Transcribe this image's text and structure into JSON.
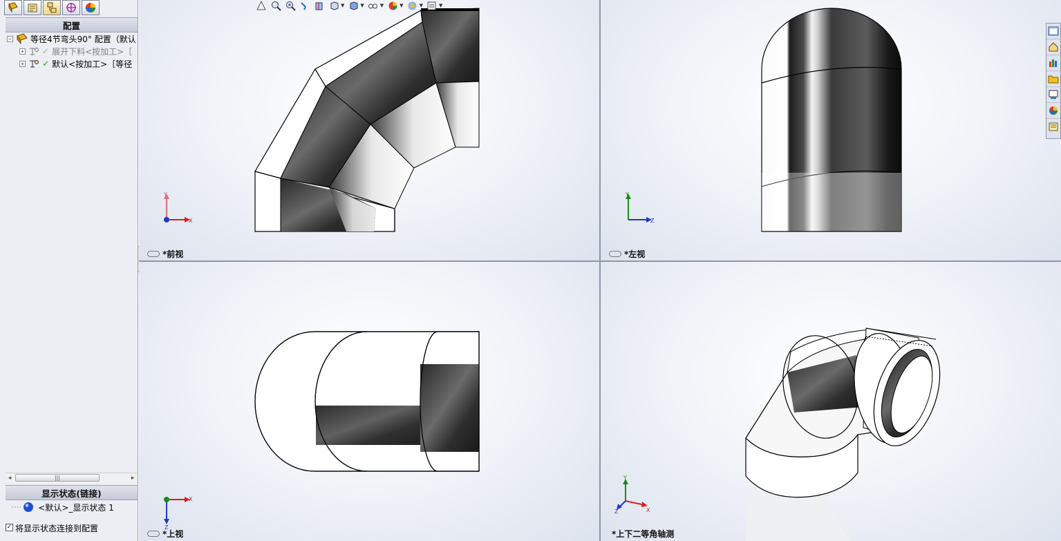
{
  "feature_manager": {
    "tabs": [
      "feature-manager-tab",
      "property-manager-tab",
      "configuration-manager-tab",
      "dimxpert-tab",
      "display-manager-tab"
    ],
    "config_header": "配置",
    "tree": [
      {
        "label": "等径4节弯头90° 配置（默认",
        "expander": "−"
      },
      {
        "label": "展开下料<按加工>［",
        "expander": "+"
      },
      {
        "label": "默认<按加工>［等径",
        "expander": "+"
      }
    ],
    "display_state_header": "显示状态(链接)",
    "display_state_item": "<默认>_显示状态 1",
    "link_checkbox_label": "将显示状态连接到配置",
    "link_checkbox_checked": true
  },
  "viewports": {
    "front": {
      "label": "*前视",
      "axis": [
        "Y",
        "X"
      ]
    },
    "left": {
      "label": "*左视",
      "axis": [
        "Y",
        "Z"
      ]
    },
    "top": {
      "label": "*上视",
      "axis": [
        "X",
        "Z"
      ]
    },
    "iso": {
      "label": "*上下二等角轴测",
      "axis": [
        "Y",
        "X",
        "Z"
      ]
    }
  },
  "heads_up_toolbar": [
    "view-orientation-icon",
    "zoom-to-fit-icon",
    "zoom-to-area-icon",
    "previous-view-icon",
    "section-view-icon",
    "view-orientation-dropdown-icon",
    "display-style-icon",
    "hide-show-items-icon",
    "edit-appearance-icon",
    "apply-scene-icon",
    "view-settings-icon"
  ],
  "task_pane": [
    "solidworks-resources-icon",
    "home-icon",
    "design-library-icon",
    "file-explorer-icon",
    "view-palette-icon",
    "appearances-icon",
    "custom-properties-icon"
  ],
  "colors": {
    "x_axis": "#d42020",
    "y_axis": "#1a8a1a",
    "z_axis": "#1a3ad0",
    "panel": "#eceef4"
  }
}
